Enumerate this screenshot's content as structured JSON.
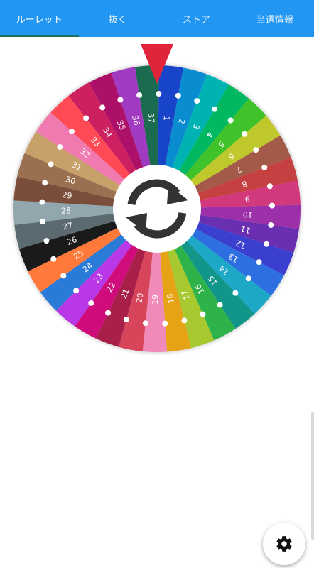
{
  "tabs": [
    {
      "label": "ルーレット",
      "active": true
    },
    {
      "label": "抜く",
      "active": false
    },
    {
      "label": "ストア",
      "active": false
    },
    {
      "label": "当選情報",
      "active": false
    }
  ],
  "colors": {
    "tab_bar": "#2196F3",
    "active_indicator": "#1e6f5c",
    "pointer": "#e0253a",
    "center_icon": "#333333"
  },
  "wheel": {
    "segments": [
      {
        "number": "37",
        "color": "#1a6b50"
      },
      {
        "number": "1",
        "color": "#1744c8"
      },
      {
        "number": "2",
        "color": "#0a8cd0"
      },
      {
        "number": "3",
        "color": "#00b3b3"
      },
      {
        "number": "4",
        "color": "#00b862"
      },
      {
        "number": "5",
        "color": "#3fc22a"
      },
      {
        "number": "6",
        "color": "#c0c92b"
      },
      {
        "number": "7",
        "color": "#a45a48"
      },
      {
        "number": "8",
        "color": "#c54040"
      },
      {
        "number": "9",
        "color": "#d2387c"
      },
      {
        "number": "10",
        "color": "#9b30a8"
      },
      {
        "number": "11",
        "color": "#6a2eb0"
      },
      {
        "number": "12",
        "color": "#3b3fd0"
      },
      {
        "number": "13",
        "color": "#2d6fe0"
      },
      {
        "number": "14",
        "color": "#1ea8c8"
      },
      {
        "number": "15",
        "color": "#13968a"
      },
      {
        "number": "16",
        "color": "#2db34a"
      },
      {
        "number": "17",
        "color": "#a7c92f"
      },
      {
        "number": "18",
        "color": "#e7a316"
      },
      {
        "number": "19",
        "color": "#f08ab8"
      },
      {
        "number": "20",
        "color": "#d8455a"
      },
      {
        "number": "21",
        "color": "#a8204a"
      },
      {
        "number": "22",
        "color": "#d00c7c"
      },
      {
        "number": "23",
        "color": "#b838e8"
      },
      {
        "number": "24",
        "color": "#2a7ad8"
      },
      {
        "number": "25",
        "color": "#ff7a3a"
      },
      {
        "number": "26",
        "color": "#1a1a1a"
      },
      {
        "number": "27",
        "color": "#5a6a70"
      },
      {
        "number": "28",
        "color": "#92a6ad"
      },
      {
        "number": "29",
        "color": "#7a4e3a"
      },
      {
        "number": "30",
        "color": "#9a7050"
      },
      {
        "number": "31",
        "color": "#c8a06a"
      },
      {
        "number": "32",
        "color": "#f07ab0"
      },
      {
        "number": "33",
        "color": "#ff4a55"
      },
      {
        "number": "34",
        "color": "#cc2060"
      },
      {
        "number": "35",
        "color": "#ad1068"
      },
      {
        "number": "36",
        "color": "#a03ac0"
      }
    ]
  },
  "icons": {
    "center": "refresh-icon",
    "pointer": "pointer-triangle-icon",
    "settings": "gear-icon"
  }
}
